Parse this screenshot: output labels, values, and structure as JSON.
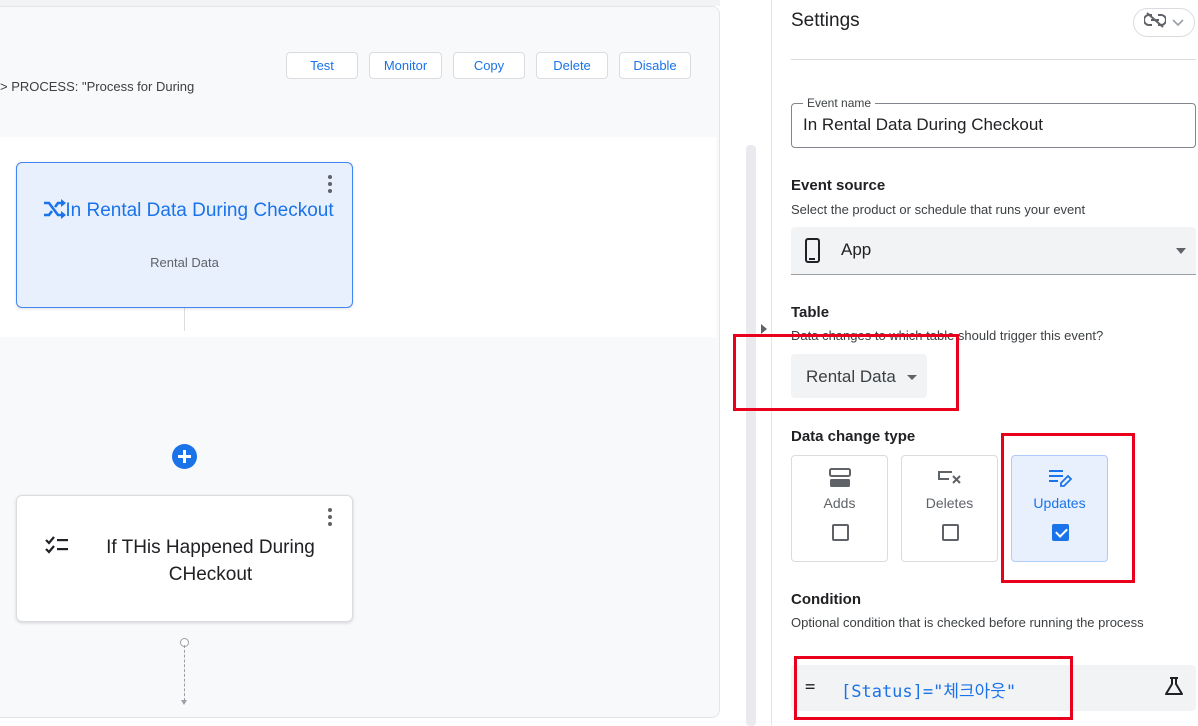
{
  "canvas": {
    "toolbar": {
      "buttons": [
        {
          "label": "Test"
        },
        {
          "label": "Monitor"
        },
        {
          "label": "Copy"
        },
        {
          "label": "Delete"
        },
        {
          "label": "Disable"
        }
      ]
    },
    "breadcrumb": "> PROCESS: \"Process for During",
    "event_card": {
      "title": "In Rental Data During Checkout",
      "subtitle": "Rental Data",
      "icon": "shuffle-icon"
    },
    "step_card": {
      "title": "If THis Happened During CHeckout",
      "icon": "checklist-icon"
    }
  },
  "settings": {
    "title": "Settings",
    "event_name": {
      "label": "Event name",
      "value": "In Rental Data During Checkout"
    },
    "event_source": {
      "title": "Event source",
      "description": "Select the product or schedule that runs your event",
      "value": "App",
      "icon": "phone-icon"
    },
    "table": {
      "title": "Table",
      "description": "Data changes to which table should trigger this event?",
      "value": "Rental Data"
    },
    "data_change_type": {
      "title": "Data change type",
      "options": [
        {
          "label": "Adds",
          "checked": false,
          "icon": "adds-icon"
        },
        {
          "label": "Deletes",
          "checked": false,
          "icon": "deletes-icon"
        },
        {
          "label": "Updates",
          "checked": true,
          "icon": "updates-icon"
        }
      ]
    },
    "condition": {
      "title": "Condition",
      "description": "Optional condition that is checked before running the process",
      "operator": "=",
      "expression": "[Status]=\"체크아웃\""
    }
  },
  "colors": {
    "accent": "#1a73e8",
    "selected_bg": "#e8f0fe",
    "highlight": "#e8001c"
  }
}
